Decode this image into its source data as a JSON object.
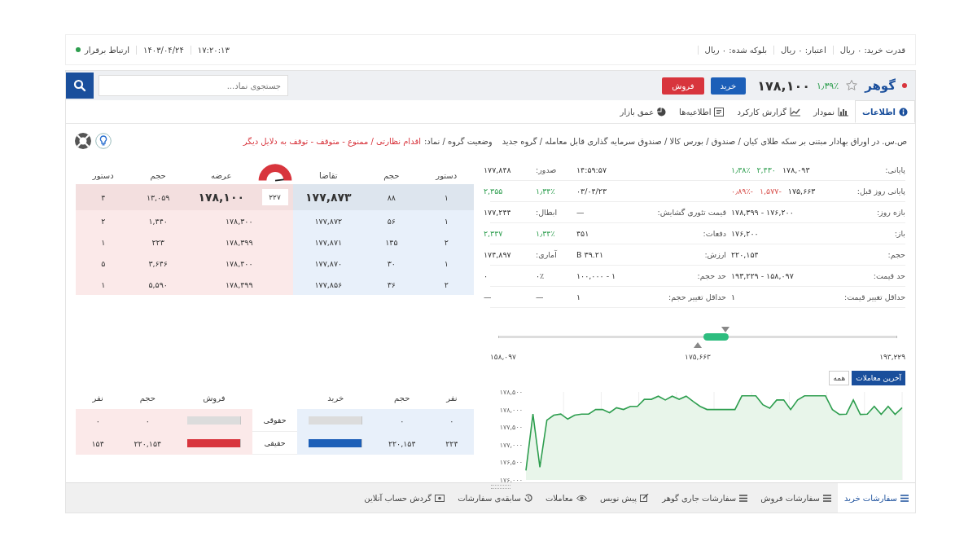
{
  "account_bar": {
    "items": [
      {
        "text": "قدرت خرید: ۰ ریال"
      },
      {
        "text": "اعتبار: ۰ ریال"
      },
      {
        "text": "بلوکه شده: ۰ ریال"
      }
    ],
    "time": "۱۷:۲۰:۱۳",
    "date": "۱۴۰۳/۰۴/۲۴",
    "connection": {
      "text": "ارتباط برقرار",
      "connected": true
    }
  },
  "symbol": {
    "name": "گوهر",
    "starred": false,
    "change": "۱٫۳۹٪",
    "kind": "up",
    "price": "۱۷۸,۱۰۰",
    "buy_button": "خرید",
    "sell_button": "فروش"
  },
  "search": {
    "placeholder": "جستجوی نماد..."
  },
  "tabs": [
    {
      "label": "اطلاعات",
      "selected": true
    },
    {
      "label": "نمودار",
      "selected": false
    },
    {
      "label": "گزارش کارکرد",
      "selected": false
    },
    {
      "label": "اطلاعیه‌ها",
      "selected": false
    },
    {
      "label": "عمق بازار",
      "selected": false
    }
  ],
  "info_line": {
    "path": "ص.س. در اوراق بهادار مبتنی بر سکه طلای کیان / صندوق / بورس کالا / صندوق سرمایه گذاری قابل معامله / گروه جدید",
    "status_label": "وضعیت گروه / نماد:",
    "status": "اقدام نظارتی / ممنوع - متوقف - توقف به دلایل دیگر"
  },
  "info_table": [
    {
      "cells": [
        {
          "parts": [
            {
              "text": "پایانی:",
              "kind": "label"
            }
          ]
        },
        {
          "parts": [
            {
              "text": "۱۷۸,۰۹۳",
              "kind": "value"
            },
            {
              "text": "۲,۴۳۰",
              "kind": "up"
            },
            {
              "text": "۱٫۳۸٪",
              "kind": "up"
            }
          ]
        },
        {},
        {
          "parts": [
            {
              "text": "۱۴:۵۹:۵۷",
              "kind": "value"
            }
          ]
        },
        {
          "parts": [
            {
              "text": "صدور:",
              "kind": "label"
            }
          ]
        },
        {
          "parts": [
            {
              "text": "۱۷۷,۸۴۸",
              "kind": "value"
            }
          ]
        }
      ]
    },
    {
      "cells": [
        {
          "parts": [
            {
              "text": "پایانی روز قبل:",
              "kind": "label"
            }
          ]
        },
        {
          "parts": [
            {
              "text": "۱۷۵,۶۶۳",
              "kind": "value"
            },
            {
              "text": "-۱,۵۷۷",
              "kind": "down"
            },
            {
              "text": "-۰٫۸۹٪",
              "kind": "down"
            }
          ]
        },
        {},
        {
          "parts": [
            {
              "text": "۰۳/۰۴/۲۳",
              "kind": "value"
            }
          ]
        },
        {
          "parts": [
            {
              "text": "۱٫۳۴٪",
              "kind": "up"
            }
          ]
        },
        {
          "parts": [
            {
              "text": "۲,۳۵۵",
              "kind": "up"
            }
          ]
        }
      ]
    },
    {
      "cells": [
        {
          "parts": [
            {
              "text": "بازه روز:",
              "kind": "label"
            }
          ]
        },
        {
          "parts": [
            {
              "text": "۱۷۶,۲۰۰ - ۱۷۸,۳۹۹",
              "kind": "value"
            }
          ]
        },
        {
          "parts": [
            {
              "text": "قیمت تئوری گشایش:",
              "kind": "label"
            }
          ]
        },
        {
          "parts": [
            {
              "text": "—",
              "kind": "value"
            }
          ]
        },
        {
          "parts": [
            {
              "text": "ابطال:",
              "kind": "label"
            }
          ]
        },
        {
          "parts": [
            {
              "text": "۱۷۷,۲۴۴",
              "kind": "value"
            }
          ]
        }
      ]
    },
    {
      "cells": [
        {
          "parts": [
            {
              "text": "باز:",
              "kind": "label"
            }
          ]
        },
        {
          "parts": [
            {
              "text": "۱۷۶,۲۰۰",
              "kind": "value"
            }
          ]
        },
        {
          "parts": [
            {
              "text": "دفعات:",
              "kind": "label"
            }
          ]
        },
        {
          "parts": [
            {
              "text": "۴۵۱",
              "kind": "value"
            }
          ]
        },
        {
          "parts": [
            {
              "text": "۱٫۳۴٪",
              "kind": "up"
            }
          ]
        },
        {
          "parts": [
            {
              "text": "۲,۳۴۷",
              "kind": "up"
            }
          ]
        }
      ]
    },
    {
      "cells": [
        {
          "parts": [
            {
              "text": "حجم:",
              "kind": "label"
            }
          ]
        },
        {
          "parts": [
            {
              "text": "۲۲۰,۱۵۴",
              "kind": "value"
            }
          ]
        },
        {
          "parts": [
            {
              "text": "ارزش:",
              "kind": "label"
            }
          ]
        },
        {
          "parts": [
            {
              "text": "۳۹.۲۱ B",
              "kind": "value"
            }
          ]
        },
        {
          "parts": [
            {
              "text": "آماری:",
              "kind": "label"
            }
          ]
        },
        {
          "parts": [
            {
              "text": "۱۷۴,۸۹۷",
              "kind": "value"
            }
          ]
        }
      ]
    },
    {
      "cells": [
        {
          "parts": [
            {
              "text": "حد قیمت:",
              "kind": "label"
            }
          ]
        },
        {
          "parts": [
            {
              "text": "۱۵۸,۰۹۷ - ۱۹۳,۲۲۹",
              "kind": "value"
            }
          ]
        },
        {
          "parts": [
            {
              "text": "حد حجم:",
              "kind": "label"
            }
          ]
        },
        {
          "parts": [
            {
              "text": "۱ - ۱۰۰,۰۰۰",
              "kind": "value"
            }
          ]
        },
        {
          "parts": [
            {
              "text": "۰٪",
              "kind": "value"
            }
          ]
        },
        {
          "parts": [
            {
              "text": "۰",
              "kind": "value"
            }
          ]
        }
      ]
    },
    {
      "cells": [
        {
          "parts": [
            {
              "text": "حداقل تغییر قیمت:",
              "kind": "label"
            }
          ]
        },
        {
          "parts": [
            {
              "text": "۱",
              "kind": "value"
            }
          ]
        },
        {
          "parts": [
            {
              "text": "حداقل تغییر حجم:",
              "kind": "label"
            }
          ]
        },
        {
          "parts": [
            {
              "text": "۱",
              "kind": "value"
            }
          ]
        },
        {
          "parts": [
            {
              "text": "—",
              "kind": "value"
            }
          ]
        },
        {
          "parts": [
            {
              "text": "—",
              "kind": "value"
            }
          ]
        }
      ]
    }
  ],
  "price_range": {
    "min": "۱۵۸,۰۹۷",
    "mid": "۱۷۵,۶۶۳",
    "max": "۱۹۳,۲۲۹",
    "prev_close": {
      "level": 0.5
    },
    "close": {
      "level": 0.569
    },
    "day_low": {
      "level": 0.515
    },
    "day_high": {
      "level": 0.578
    }
  },
  "order_book": {
    "columns": [
      "دستور",
      "حجم",
      "تقاضا",
      "عرضه",
      "حجم",
      "دستور"
    ],
    "spread": "۲۲۷",
    "rows": [
      {
        "buy_count": "۱",
        "buy_volume": "۸۸",
        "bid": "۱۷۷,۸۷۳",
        "ask": "۱۷۸,۱۰۰",
        "sell_volume": "۱۳,۰۵۹",
        "sell_count": "۴"
      },
      {
        "buy_count": "۱",
        "buy_volume": "۵۶",
        "bid": "۱۷۷,۸۷۲",
        "ask": "۱۷۸,۳۰۰",
        "sell_volume": "۱,۴۴۰",
        "sell_count": "۲"
      },
      {
        "buy_count": "۲",
        "buy_volume": "۱۴۵",
        "bid": "۱۷۷,۸۷۱",
        "ask": "۱۷۸,۳۹۹",
        "sell_volume": "۲۲۳",
        "sell_count": "۱"
      },
      {
        "buy_count": "۱",
        "buy_volume": "۳۰",
        "bid": "۱۷۷,۸۷۰",
        "ask": "۱۷۸,۴۰۰",
        "sell_volume": "۳,۶۴۶",
        "sell_count": "۵"
      },
      {
        "buy_count": "۲",
        "buy_volume": "۳۶",
        "bid": "۱۷۷,۸۵۶",
        "ask": "۱۷۸,۴۹۹",
        "sell_volume": "۵,۵۹۰",
        "sell_count": "۱"
      }
    ]
  },
  "traders": {
    "columns": [
      "نفر",
      "حجم",
      "خرید",
      "فروش",
      "حجم",
      "نفر"
    ],
    "rows": [
      {
        "label": "حقوقی",
        "buy": {
          "count": "۰",
          "volume": "۰",
          "level": 0
        },
        "sell": {
          "count": "۰",
          "volume": "۰",
          "level": 0
        }
      },
      {
        "label": "حقیقی",
        "buy": {
          "count": "۲۲۴",
          "volume": "۲۲۰,۱۵۴",
          "level": 1
        },
        "sell": {
          "count": "۱۵۴",
          "volume": "۲۲۰,۱۵۴",
          "level": 1
        }
      }
    ]
  },
  "trades": {
    "buttons": [
      {
        "label": "آخرین معاملات",
        "selected": true
      },
      {
        "label": "همه",
        "selected": false
      }
    ],
    "chart_data": {
      "type": "line",
      "grid": true,
      "ylim": [
        176000,
        178500
      ],
      "yticks": [
        {
          "value": 176000,
          "label": "۱۷۶,۰۰۰"
        },
        {
          "value": 176500,
          "label": "۱۷۶,۵۰۰"
        },
        {
          "value": 177000,
          "label": "۱۷۷,۰۰۰"
        },
        {
          "value": 177500,
          "label": "۱۷۷,۵۰۰"
        },
        {
          "value": 178000,
          "label": "۱۷۸,۰۰۰"
        },
        {
          "value": 178500,
          "label": "۱۷۸,۵۰۰"
        }
      ],
      "series": [
        {
          "color": "#2e9e4f",
          "values": [
            176270,
            177870,
            176360,
            177700,
            177840,
            177870,
            177730,
            177840,
            177870,
            177870,
            178000,
            178000,
            177910,
            178050,
            178000,
            178090,
            178090,
            178290,
            178290,
            178380,
            178270,
            178380,
            178290,
            178380,
            178230,
            178090,
            178000,
            178000,
            178000,
            178000,
            178000,
            178390,
            178390,
            178390,
            178140,
            178040,
            178270,
            178270,
            178000,
            178270,
            178390,
            178390,
            178390,
            178390,
            178000,
            177860,
            177870,
            178270,
            177860,
            177870,
            178090,
            177860,
            178090,
            177860,
            178050
          ]
        }
      ]
    }
  },
  "bottom_tabs": [
    {
      "label": "سفارشات خرید",
      "selected": true
    },
    {
      "label": "سفارشات فروش",
      "selected": false
    },
    {
      "label": "سفارشات جاری گوهر",
      "selected": false
    },
    {
      "label": "پیش نویس",
      "selected": false
    },
    {
      "label": "معاملات",
      "selected": false
    },
    {
      "label": "سابقه‌ی سفارشات",
      "selected": false
    },
    {
      "label": "گردش حساب آنلاین",
      "selected": false
    }
  ]
}
